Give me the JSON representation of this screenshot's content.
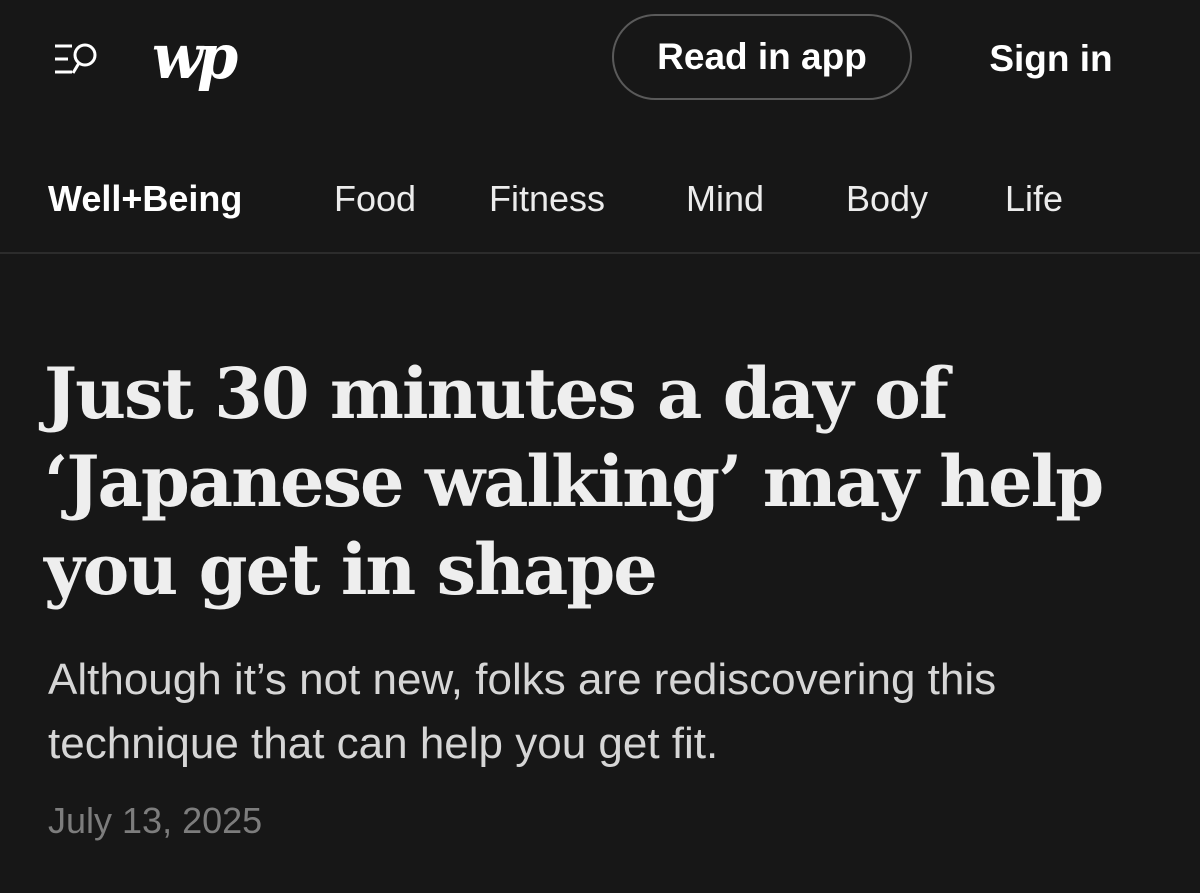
{
  "header": {
    "logo_text": "wp",
    "logo_icon": "washington-post-logo",
    "menu_icon": "menu-search-icon",
    "read_in_app_label": "Read in app",
    "sign_in_label": "Sign in"
  },
  "section_nav": {
    "items": [
      {
        "label": "Well+Being",
        "active": true
      },
      {
        "label": "Food",
        "active": false
      },
      {
        "label": "Fitness",
        "active": false
      },
      {
        "label": "Mind",
        "active": false
      },
      {
        "label": "Body",
        "active": false
      },
      {
        "label": "Life",
        "active": false
      }
    ]
  },
  "article": {
    "headline": "Just 30 minutes a day of ‘Japanese walking’ may help you get in shape",
    "subheadline": "Although it’s not new, folks are rediscovering this technique that can help you get fit.",
    "date": "July 13, 2025"
  },
  "colors": {
    "background": "#171717",
    "text_primary": "#ffffff",
    "text_secondary": "#d6d6d6",
    "text_muted": "#7d7d7d",
    "border": "#5a5a5a"
  }
}
